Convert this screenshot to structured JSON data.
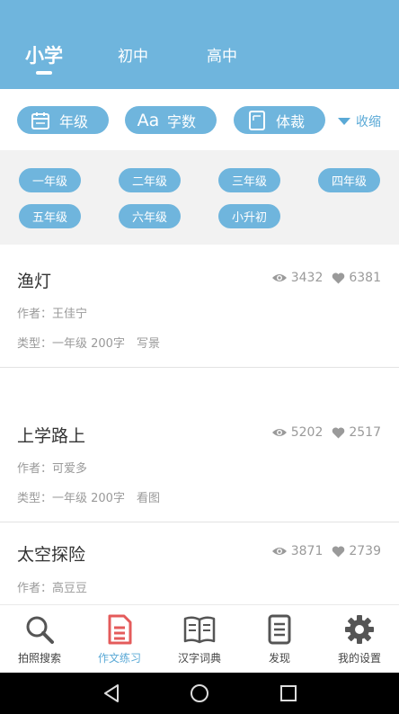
{
  "header": {
    "tabs": [
      {
        "label": "小学"
      },
      {
        "label": "初中"
      },
      {
        "label": "高中"
      }
    ]
  },
  "filters": {
    "grade": "年级",
    "word_count": "字数",
    "genre": "体裁",
    "collapse": "收缩",
    "icons": [
      "calendar-icon",
      "text-size-icon",
      "document-icon",
      "triangle-down-icon"
    ]
  },
  "grades": [
    "一年级",
    "二年级",
    "三年级",
    "四年级",
    "五年级",
    "六年级",
    "小升初"
  ],
  "articles": [
    {
      "title": "渔灯",
      "author": "作者：王佳宁",
      "meta": "类型：一年级 200字　写景",
      "views": "3432",
      "likes": "6381"
    },
    {
      "title": "上学路上",
      "author": "作者：可爱多",
      "meta": "类型：一年级 200字　看图",
      "views": "5202",
      "likes": "2517"
    },
    {
      "title": "太空探险",
      "author": "作者：高豆豆",
      "views": "3871",
      "likes": "2739"
    }
  ],
  "bottom_nav": [
    {
      "label": "拍照搜索",
      "icon": "search-icon"
    },
    {
      "label": "作文练习",
      "icon": "document-icon"
    },
    {
      "label": "汉字词典",
      "icon": "book-icon"
    },
    {
      "label": "发现",
      "icon": "list-icon"
    },
    {
      "label": "我的设置",
      "icon": "gear-icon"
    }
  ],
  "colors": {
    "accent": "#6fb5dd",
    "active_nav": "#e45b5b",
    "text_gray": "#9a9a9a"
  }
}
